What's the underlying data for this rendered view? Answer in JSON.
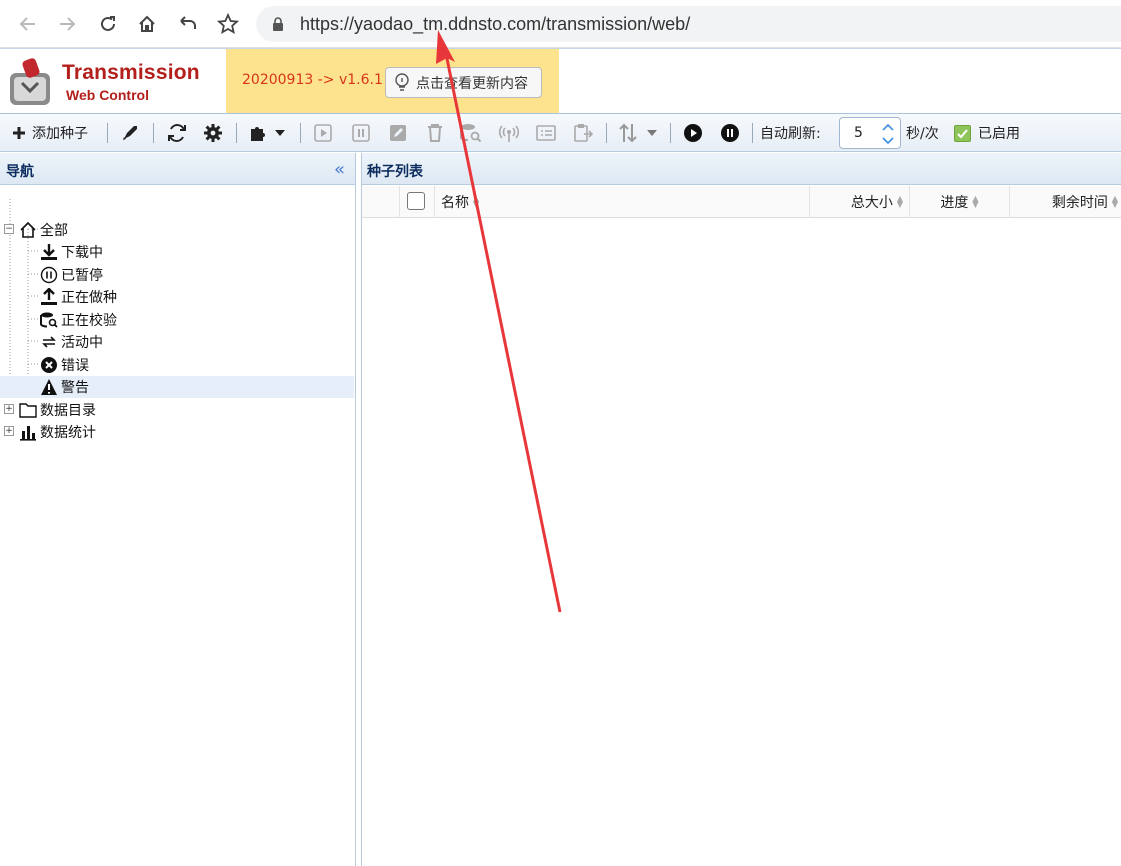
{
  "browser": {
    "url": "https://yaodao_tm.ddnsto.com/transmission/web/"
  },
  "app": {
    "logo_title": "Transmission",
    "logo_subtitle": "Web Control",
    "update_version": "20200913 -> v1.6.1",
    "update_button": "点击查看更新内容"
  },
  "toolbar": {
    "add_torrent": "添加种子",
    "auto_refresh_label": "自动刷新:",
    "refresh_value": "5",
    "refresh_unit": "秒/次",
    "enabled_label": "已启用"
  },
  "nav": {
    "title": "导航",
    "items": [
      {
        "label": "全部",
        "icon": "home-icon"
      },
      {
        "label": "下载中",
        "icon": "download-icon"
      },
      {
        "label": "已暂停",
        "icon": "pause-circle-icon"
      },
      {
        "label": "正在做种",
        "icon": "upload-icon"
      },
      {
        "label": "正在校验",
        "icon": "database-search-icon"
      },
      {
        "label": "活动中",
        "icon": "exchange-icon"
      },
      {
        "label": "错误",
        "icon": "error-icon"
      },
      {
        "label": "警告",
        "icon": "warning-icon"
      },
      {
        "label": "数据目录",
        "icon": "folder-icon"
      },
      {
        "label": "数据统计",
        "icon": "bar-chart-icon"
      }
    ]
  },
  "torrents": {
    "title": "种子列表",
    "columns": [
      "名称",
      "总大小",
      "进度",
      "剩余时间"
    ]
  },
  "colors": {
    "accent_red": "#b3201c",
    "update_bg": "#fde38d",
    "annotation_arrow": "#e8373a"
  }
}
